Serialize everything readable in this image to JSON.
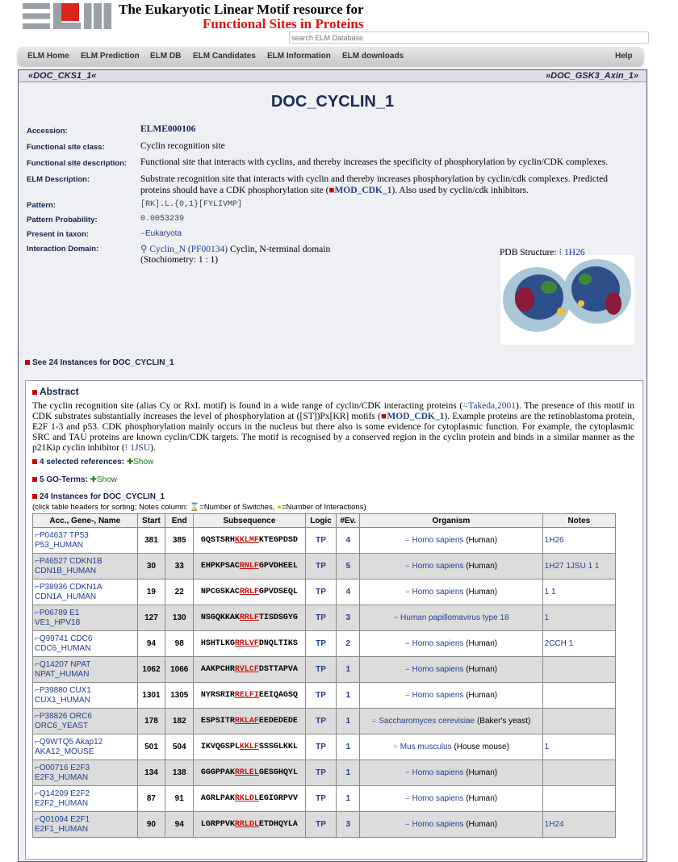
{
  "header": {
    "title_line1": "The Eukaryotic Linear Motif resource for",
    "title_line2": "Functional Sites in Proteins",
    "search_placeholder": "search ELM Database"
  },
  "nav": [
    "ELM Home",
    "ELM Prediction",
    "ELM DB",
    "ELM Candidates",
    "ELM Information",
    "ELM downloads",
    "Help"
  ],
  "docnav": {
    "prev": "«DOC_CKS1_1«",
    "next": "»DOC_GSK3_Axin_1»"
  },
  "title": "DOC_CYCLIN_1",
  "fields": {
    "accession_label": "Accession:",
    "accession": "ELME000106",
    "class_label": "Functional site class:",
    "class": "Cyclin recognition site",
    "desc_label": "Functional site description:",
    "desc": "Functional site that interacts with cyclins, and thereby increases the specificity of phosphorylation by cyclin/CDK complexes.",
    "elmdesc_label": "ELM Description:",
    "elmdesc_1": "Substrate recognition site that interacts with cyclin and thereby increases phosphorylation by cyclin/cdk complexes. Predicted",
    "elmdesc_2": "proteins should have a CDK phosphorylation site (",
    "elmdesc_link": "MOD_CDK_1",
    "elmdesc_3": "). Also used by cyclin/cdk inhibitors.",
    "pattern_label": "Pattern:",
    "pattern": "[RK].L.{0,1}[FYLIVMP]",
    "prob_label": "Pattern Probability:",
    "prob": "0.0053239",
    "taxon_label": "Present in taxon:",
    "taxon": "Eukaryota",
    "domain_label": "Interaction Domain:",
    "domain_link": "Cyclin_N (PF00134)",
    "domain_text": "Cyclin, N-terminal domain",
    "stoich": "(Stochiometry: 1 : 1)",
    "pdb_label": "PDB Structure:",
    "pdb": "1H26"
  },
  "see_instances": "See 24 Instances for DOC_CYCLIN_1",
  "abstract": {
    "heading": "Abstract",
    "p1": "The cyclin recognition site (alias Cy or RxL motif) is found in a wide range of cyclin/CDK interacting proteins (",
    "ref1": "Takeda,2001",
    "p2": "). The presence of this motif in CDK substrates substantially increases the level of phosphorylation at ([ST])Px[KR] motifs (",
    "ref2": "MOD_CDK_1",
    "p3": "). Example proteins are the retinoblastoma protein, E2F 1-3 and p53. CDK phosphorylation mainly occurs in the nucleus but there also is some evidence for cytoplasmic function. For example, the cytoplasmic SRC and TAU proteins are known cyclin/CDK targets. The motif is recognised by a conserved region in the cyclin protein and binds in a similar manner as the p21Kip cyclin inhibitor (",
    "ref3": "1JSU",
    "p4": ")."
  },
  "refs": {
    "label": "4 selected references:",
    "show": "Show"
  },
  "goterms": {
    "label": "5 GO-Terms:",
    "show": "Show"
  },
  "instances": {
    "label": "24 Instances for DOC_CYCLIN_1",
    "note_a": "(click table headers for sorting; Notes column:",
    "note_b": "=Number of Switches,",
    "note_c": "=Number of Interactions)",
    "headers": [
      "Acc., Gene-, Name",
      "Start",
      "End",
      "Subsequence",
      "Logic",
      "#Ev.",
      "Organism",
      "Notes"
    ],
    "rows": [
      {
        "acc": "P04637 TP53",
        "name": "P53_HUMAN",
        "start": "381",
        "end": "385",
        "pre": "GQSTSRH",
        "motif": "KKLMF",
        "post": "KTEGPDSD",
        "logic": "TP",
        "ev": "4",
        "org": "Homo sapiens",
        "common": "(Human)",
        "notes": "1H26"
      },
      {
        "acc": "P46527 CDKN1B",
        "name": "CDN1B_HUMAN",
        "start": "30",
        "end": "33",
        "pre": "EHPKPSAC",
        "motif": "RNLF",
        "post": "GPVDHEEL",
        "logic": "TP",
        "ev": "5",
        "org": "Homo sapiens",
        "common": "(Human)",
        "notes": "1H27 1JSU 1 1"
      },
      {
        "acc": "P38936 CDKN1A",
        "name": "CDN1A_HUMAN",
        "start": "19",
        "end": "22",
        "pre": "NPCGSKAC",
        "motif": "RRLF",
        "post": "GPVDSEQL",
        "logic": "TP",
        "ev": "4",
        "org": "Homo sapiens",
        "common": "(Human)",
        "notes": "1 1"
      },
      {
        "acc": "P06789 E1",
        "name": "VE1_HPV18",
        "start": "127",
        "end": "130",
        "pre": "NSGQKKAK",
        "motif": "RRLF",
        "post": "TISDSGYG",
        "logic": "TP",
        "ev": "3",
        "org": "Human papillomavirus type 18",
        "common": "",
        "notes": "1"
      },
      {
        "acc": "Q99741 CDC6",
        "name": "CDC6_HUMAN",
        "start": "94",
        "end": "98",
        "pre": "HSHTLKG",
        "motif": "RRLVF",
        "post": "DNQLTIKS",
        "logic": "TP",
        "ev": "2",
        "org": "Homo sapiens",
        "common": "(Human)",
        "notes": "2CCH 1"
      },
      {
        "acc": "Q14207 NPAT",
        "name": "NPAT_HUMAN",
        "start": "1062",
        "end": "1066",
        "pre": "AAKPCHR",
        "motif": "RVLCF",
        "post": "DSTTAPVA",
        "logic": "TP",
        "ev": "1",
        "org": "Homo sapiens",
        "common": "(Human)",
        "notes": ""
      },
      {
        "acc": "P39880 CUX1",
        "name": "CUX1_HUMAN",
        "start": "1301",
        "end": "1305",
        "pre": "NYRSRIR",
        "motif": "RELFI",
        "post": "EEIQAGSQ",
        "logic": "TP",
        "ev": "1",
        "org": "Homo sapiens",
        "common": "(Human)",
        "notes": ""
      },
      {
        "acc": "P38826 ORC6",
        "name": "ORC6_YEAST",
        "start": "178",
        "end": "182",
        "pre": "ESPSITR",
        "motif": "RKLAF",
        "post": "EEDEDEDE",
        "logic": "TP",
        "ev": "1",
        "org": "Saccharomyces cerevisiae",
        "common": "(Baker's yeast)",
        "notes": ""
      },
      {
        "acc": "Q9WTQ5 Akap12",
        "name": "AKA12_MOUSE",
        "start": "501",
        "end": "504",
        "pre": "IKVQGSPL",
        "motif": "KKLF",
        "post": "SSSGLKKL",
        "logic": "TP",
        "ev": "1",
        "org": "Mus musculus",
        "common": "(House mouse)",
        "notes": "1"
      },
      {
        "acc": "O00716 E2F3",
        "name": "E2F3_HUMAN",
        "start": "134",
        "end": "138",
        "pre": "GGGPPAK",
        "motif": "RRLEL",
        "post": "GESGHQYL",
        "logic": "TP",
        "ev": "1",
        "org": "Homo sapiens",
        "common": "(Human)",
        "notes": ""
      },
      {
        "acc": "Q14209 E2F2",
        "name": "E2F2_HUMAN",
        "start": "87",
        "end": "91",
        "pre": "AGRLPAK",
        "motif": "RKLDL",
        "post": "EGIGRPVV",
        "logic": "TP",
        "ev": "1",
        "org": "Homo sapiens",
        "common": "(Human)",
        "notes": ""
      },
      {
        "acc": "Q01094 E2F1",
        "name": "E2F1_HUMAN",
        "start": "90",
        "end": "94",
        "pre": "LGRPPVK",
        "motif": "RRLDL",
        "post": "ETDHQYLA",
        "logic": "TP",
        "ev": "3",
        "org": "Homo sapiens",
        "common": "(Human)",
        "notes": "1H24"
      }
    ]
  }
}
